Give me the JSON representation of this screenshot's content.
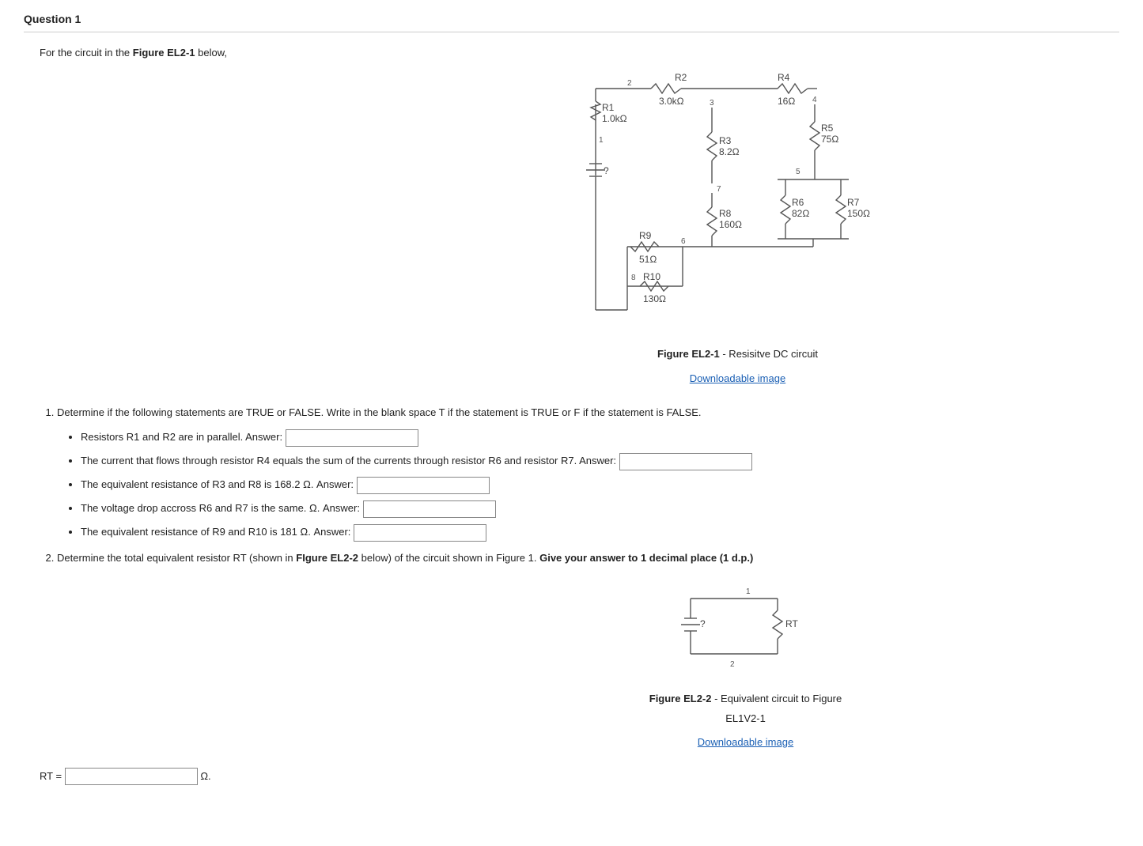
{
  "question_header": "Question 1",
  "intro_pre": "For the circuit in the ",
  "intro_bold": "Figure EL2-1",
  "intro_post": " below,",
  "figure1": {
    "caption_bold": "Figure EL2-1",
    "caption_rest": " - Resisitve DC circuit",
    "link": "Downloadable image",
    "labels": {
      "R1": "R1",
      "R1v": "1.0kΩ",
      "R2": "R2",
      "R2v": "3.0kΩ",
      "R3": "R3",
      "R3v": "8.2Ω",
      "R4": "R4",
      "R4v": "16Ω",
      "R5": "R5",
      "R5v": "75Ω",
      "R6": "R6",
      "R6v": "82Ω",
      "R7": "R7",
      "R7v": "150Ω",
      "R8": "R8",
      "R8v": "160Ω",
      "R9": "R9",
      "R9v": "51Ω",
      "R10": "R10",
      "R10v": "130Ω",
      "src": "?",
      "n1": "1",
      "n2": "2",
      "n3": "3",
      "n4": "4",
      "n5": "5",
      "n6": "6",
      "n7": "7",
      "n8": "8"
    }
  },
  "part1": {
    "prompt": "Determine if the following statements are TRUE or FALSE. Write in the blank space T if the statement is TRUE or F if the statement is FALSE.",
    "items": [
      "Resistors R1 and R2 are in parallel. Answer:",
      "The current that flows through resistor R4 equals the sum of the currents through resistor R6 and resistor R7. Answer:",
      "The equivalent resistance of R3 and R8 is 168.2 Ω. Answer:",
      "The voltage drop accross R6 and R7 is the same. Ω. Answer:",
      "The equivalent resistance of R9 and R10 is 181 Ω. Answer:"
    ]
  },
  "part2": {
    "pre1": "Determine the total equivalent resistor RT (shown in ",
    "bold1": "FIgure EL2-2",
    "mid1": " below) of the circuit shown in Figure 1.  ",
    "bold2": "Give your answer to 1 decimal place (1 d.p.)"
  },
  "figure2": {
    "caption_bold": "Figure EL2-2",
    "caption_rest": " - Equivalent circuit to Figure EL1V2-1",
    "link": "Downloadable image",
    "labels": {
      "src": "?",
      "RT": "RT",
      "n1": "1",
      "n2": "2"
    }
  },
  "rt": {
    "label_pre": "RT =",
    "unit": "Ω."
  }
}
